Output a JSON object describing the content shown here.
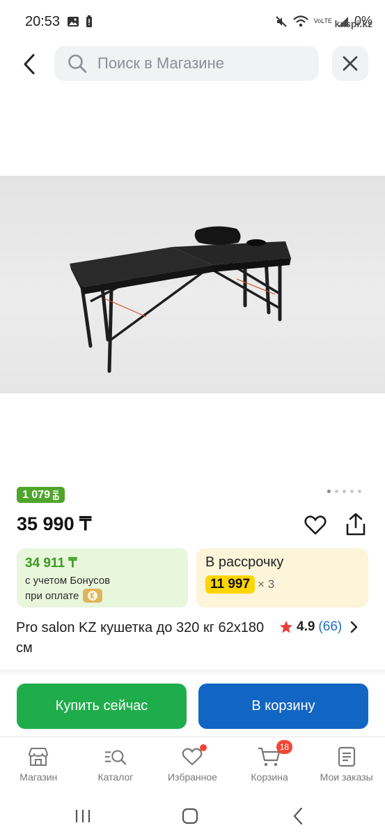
{
  "status": {
    "time": "20:53",
    "battery": "0%",
    "watermark": "kaspi.kz"
  },
  "search": {
    "placeholder": "Поиск в Магазине"
  },
  "gallery": {
    "total": 5,
    "active": 1
  },
  "product": {
    "bonus_badge": "1 079",
    "price": "35 990 ₸",
    "title": "Pro salon KZ кушетка до 320 кг 62х180 см",
    "rating": "4.9",
    "reviews": "(66)"
  },
  "bonus_card": {
    "amount": "34 911 ₸",
    "line1": "с учетом Бонусов",
    "line2": "при оплате"
  },
  "installment": {
    "title": "В рассрочку",
    "amount": "11 997",
    "multiplier": "× 3"
  },
  "actions": {
    "buy": "Купить сейчас",
    "cart": "В корзину"
  },
  "bottom_nav": {
    "items": [
      {
        "label": "Магазин"
      },
      {
        "label": "Каталог"
      },
      {
        "label": "Избранное"
      },
      {
        "label": "Корзина",
        "badge": "18"
      },
      {
        "label": "Мои заказы"
      }
    ]
  },
  "colors": {
    "green": "#1fad4b",
    "blue": "#1266c3",
    "bonus_green": "#4fa52c",
    "yellow": "#ffd500",
    "red": "#f14635"
  }
}
